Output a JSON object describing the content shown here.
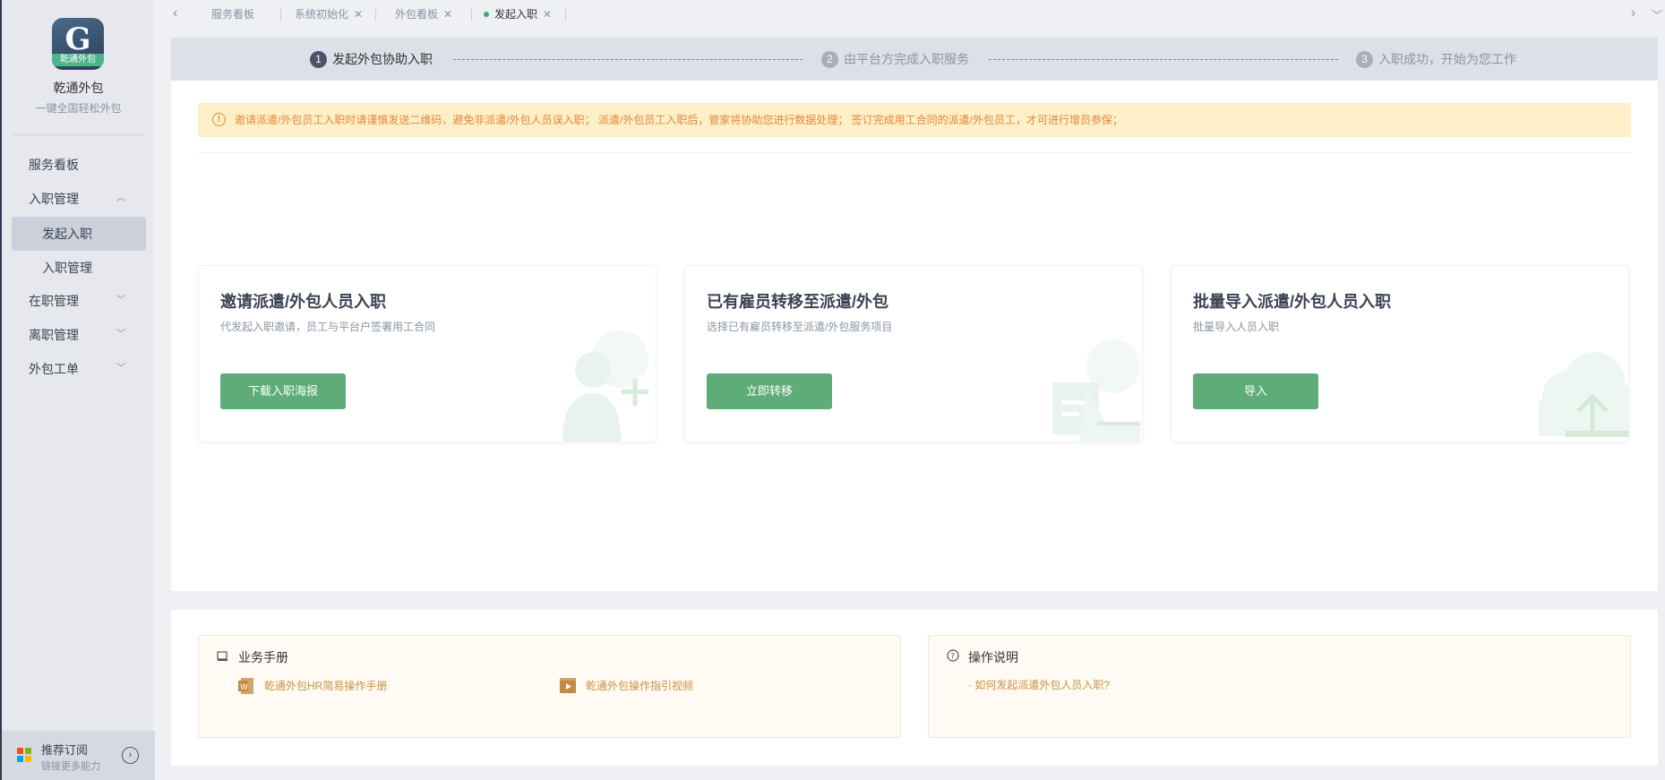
{
  "sidebar": {
    "logo_text": "乾通外包",
    "brand": "乾通外包",
    "slogan": "一键全国轻松外包",
    "items": [
      {
        "label": "服务看板"
      },
      {
        "label": "入职管理"
      },
      {
        "label": "发起入职"
      },
      {
        "label": "入职管理"
      },
      {
        "label": "在职管理"
      },
      {
        "label": "离职管理"
      },
      {
        "label": "外包工单"
      }
    ],
    "bottom": {
      "title": "推荐订阅",
      "subtitle": "链接更多能力"
    }
  },
  "tabs": [
    {
      "label": "服务看板"
    },
    {
      "label": "系统初始化"
    },
    {
      "label": "外包看板"
    },
    {
      "label": "发起入职"
    }
  ],
  "steps": [
    {
      "num": "1",
      "label": "发起外包协助入职"
    },
    {
      "num": "2",
      "label": "由平台方完成入职服务"
    },
    {
      "num": "3",
      "label": "入职成功，开始为您工作"
    }
  ],
  "alert": {
    "text": "邀请派遣/外包员工入职时请谨慎发送二维码，避免非派遣/外包人员误入职； 派遣/外包员工入职后，管家将协助您进行数据处理； 签订完成用工合同的派遣/外包员工，才可进行增员参保；"
  },
  "cards": [
    {
      "title": "邀请派遣/外包人员入职",
      "desc": "代发起入职邀请，员工与平台户签署用工合同",
      "button": "下载入职海报"
    },
    {
      "title": "已有雇员转移至派遣/外包",
      "desc": "选择已有雇员转移至派遣/外包服务项目",
      "button": "立即转移"
    },
    {
      "title": "批量导入派遣/外包人员入职",
      "desc": "批量导入人员入职",
      "button": "导入"
    }
  ],
  "help": {
    "manual_title": "业务手册",
    "manual_links": [
      "乾通外包HR简易操作手册",
      "乾通外包操作指引视频"
    ],
    "ops_title": "操作说明",
    "ops_links": [
      "· 如何发起派遣外包人员入职?"
    ]
  },
  "colors": {
    "primary_button": "#5ead78",
    "alert_text": "#e8843a",
    "alert_bg": "#fdf0c8",
    "active_dot": "#2fb36a"
  }
}
